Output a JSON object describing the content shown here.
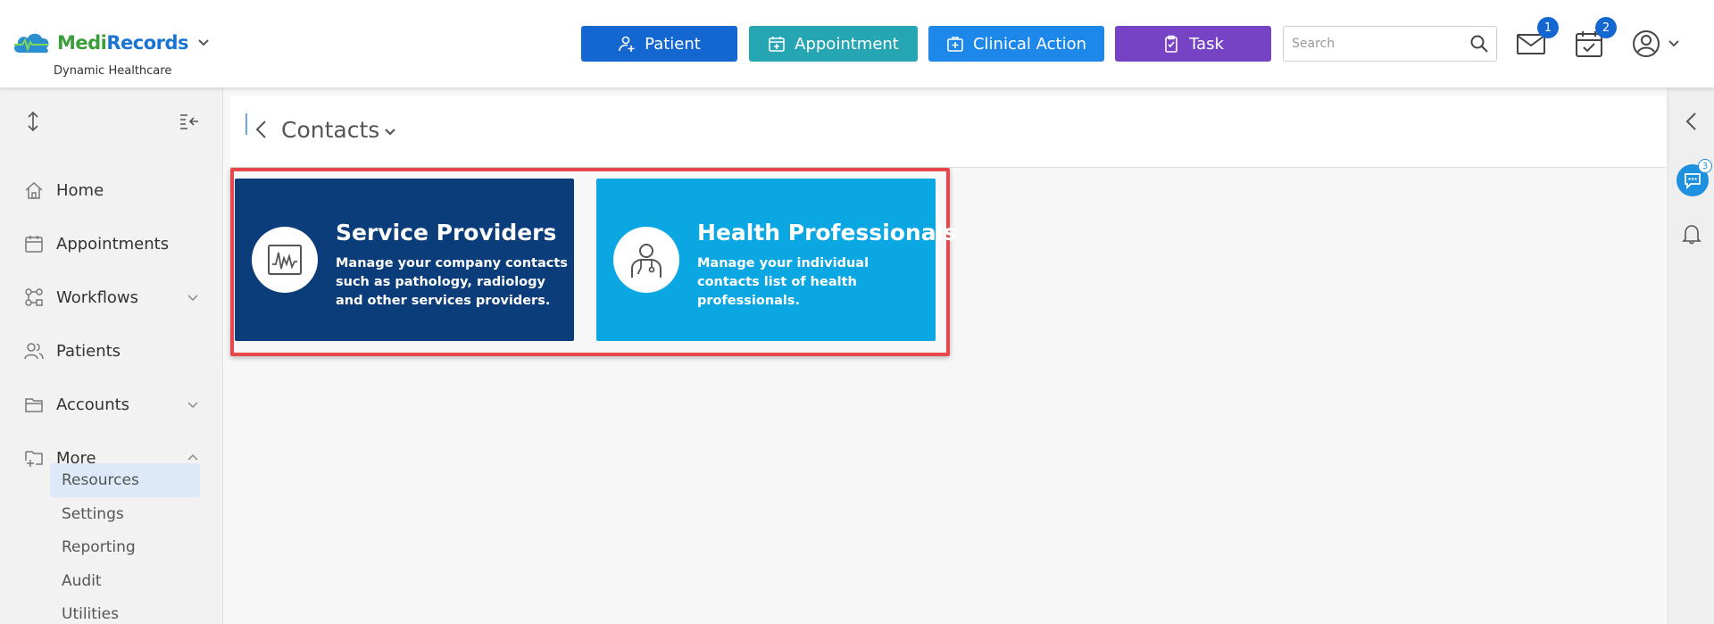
{
  "header": {
    "logo": {
      "part1": "Medi",
      "part2": "Records"
    },
    "org_name": "Dynamic Healthcare",
    "buttons": {
      "patient": "Patient",
      "appointment": "Appointment",
      "clinical_action": "Clinical Action",
      "task": "Task"
    },
    "search": {
      "placeholder": "Search"
    },
    "mail_count": "1",
    "calendar_count": "2"
  },
  "sidebar": {
    "items": [
      {
        "label": "Home"
      },
      {
        "label": "Appointments"
      },
      {
        "label": "Workflows"
      },
      {
        "label": "Patients"
      },
      {
        "label": "Accounts"
      },
      {
        "label": "More"
      }
    ],
    "sub_items": [
      {
        "label": "Resources",
        "active": true
      },
      {
        "label": "Settings"
      },
      {
        "label": "Reporting"
      },
      {
        "label": "Audit"
      },
      {
        "label": "Utilities"
      }
    ]
  },
  "page": {
    "title": "Contacts"
  },
  "cards": [
    {
      "title": "Service Providers",
      "description": "Manage your company contacts such as pathology, radiology and other services providers.",
      "icon": "activity-monitor-icon",
      "color": "#0a3d7a"
    },
    {
      "title": "Health Professionals",
      "description": "Manage your individual contacts list of health professionals.",
      "icon": "doctor-icon",
      "color": "#0aa7e3"
    }
  ],
  "right_rail": {
    "chat_count": "3"
  },
  "colors": {
    "patient": "#1467d0",
    "appointment": "#26a5b3",
    "clinical_action": "#1e88ea",
    "task": "#7543c4",
    "highlight": "#e5474b"
  }
}
